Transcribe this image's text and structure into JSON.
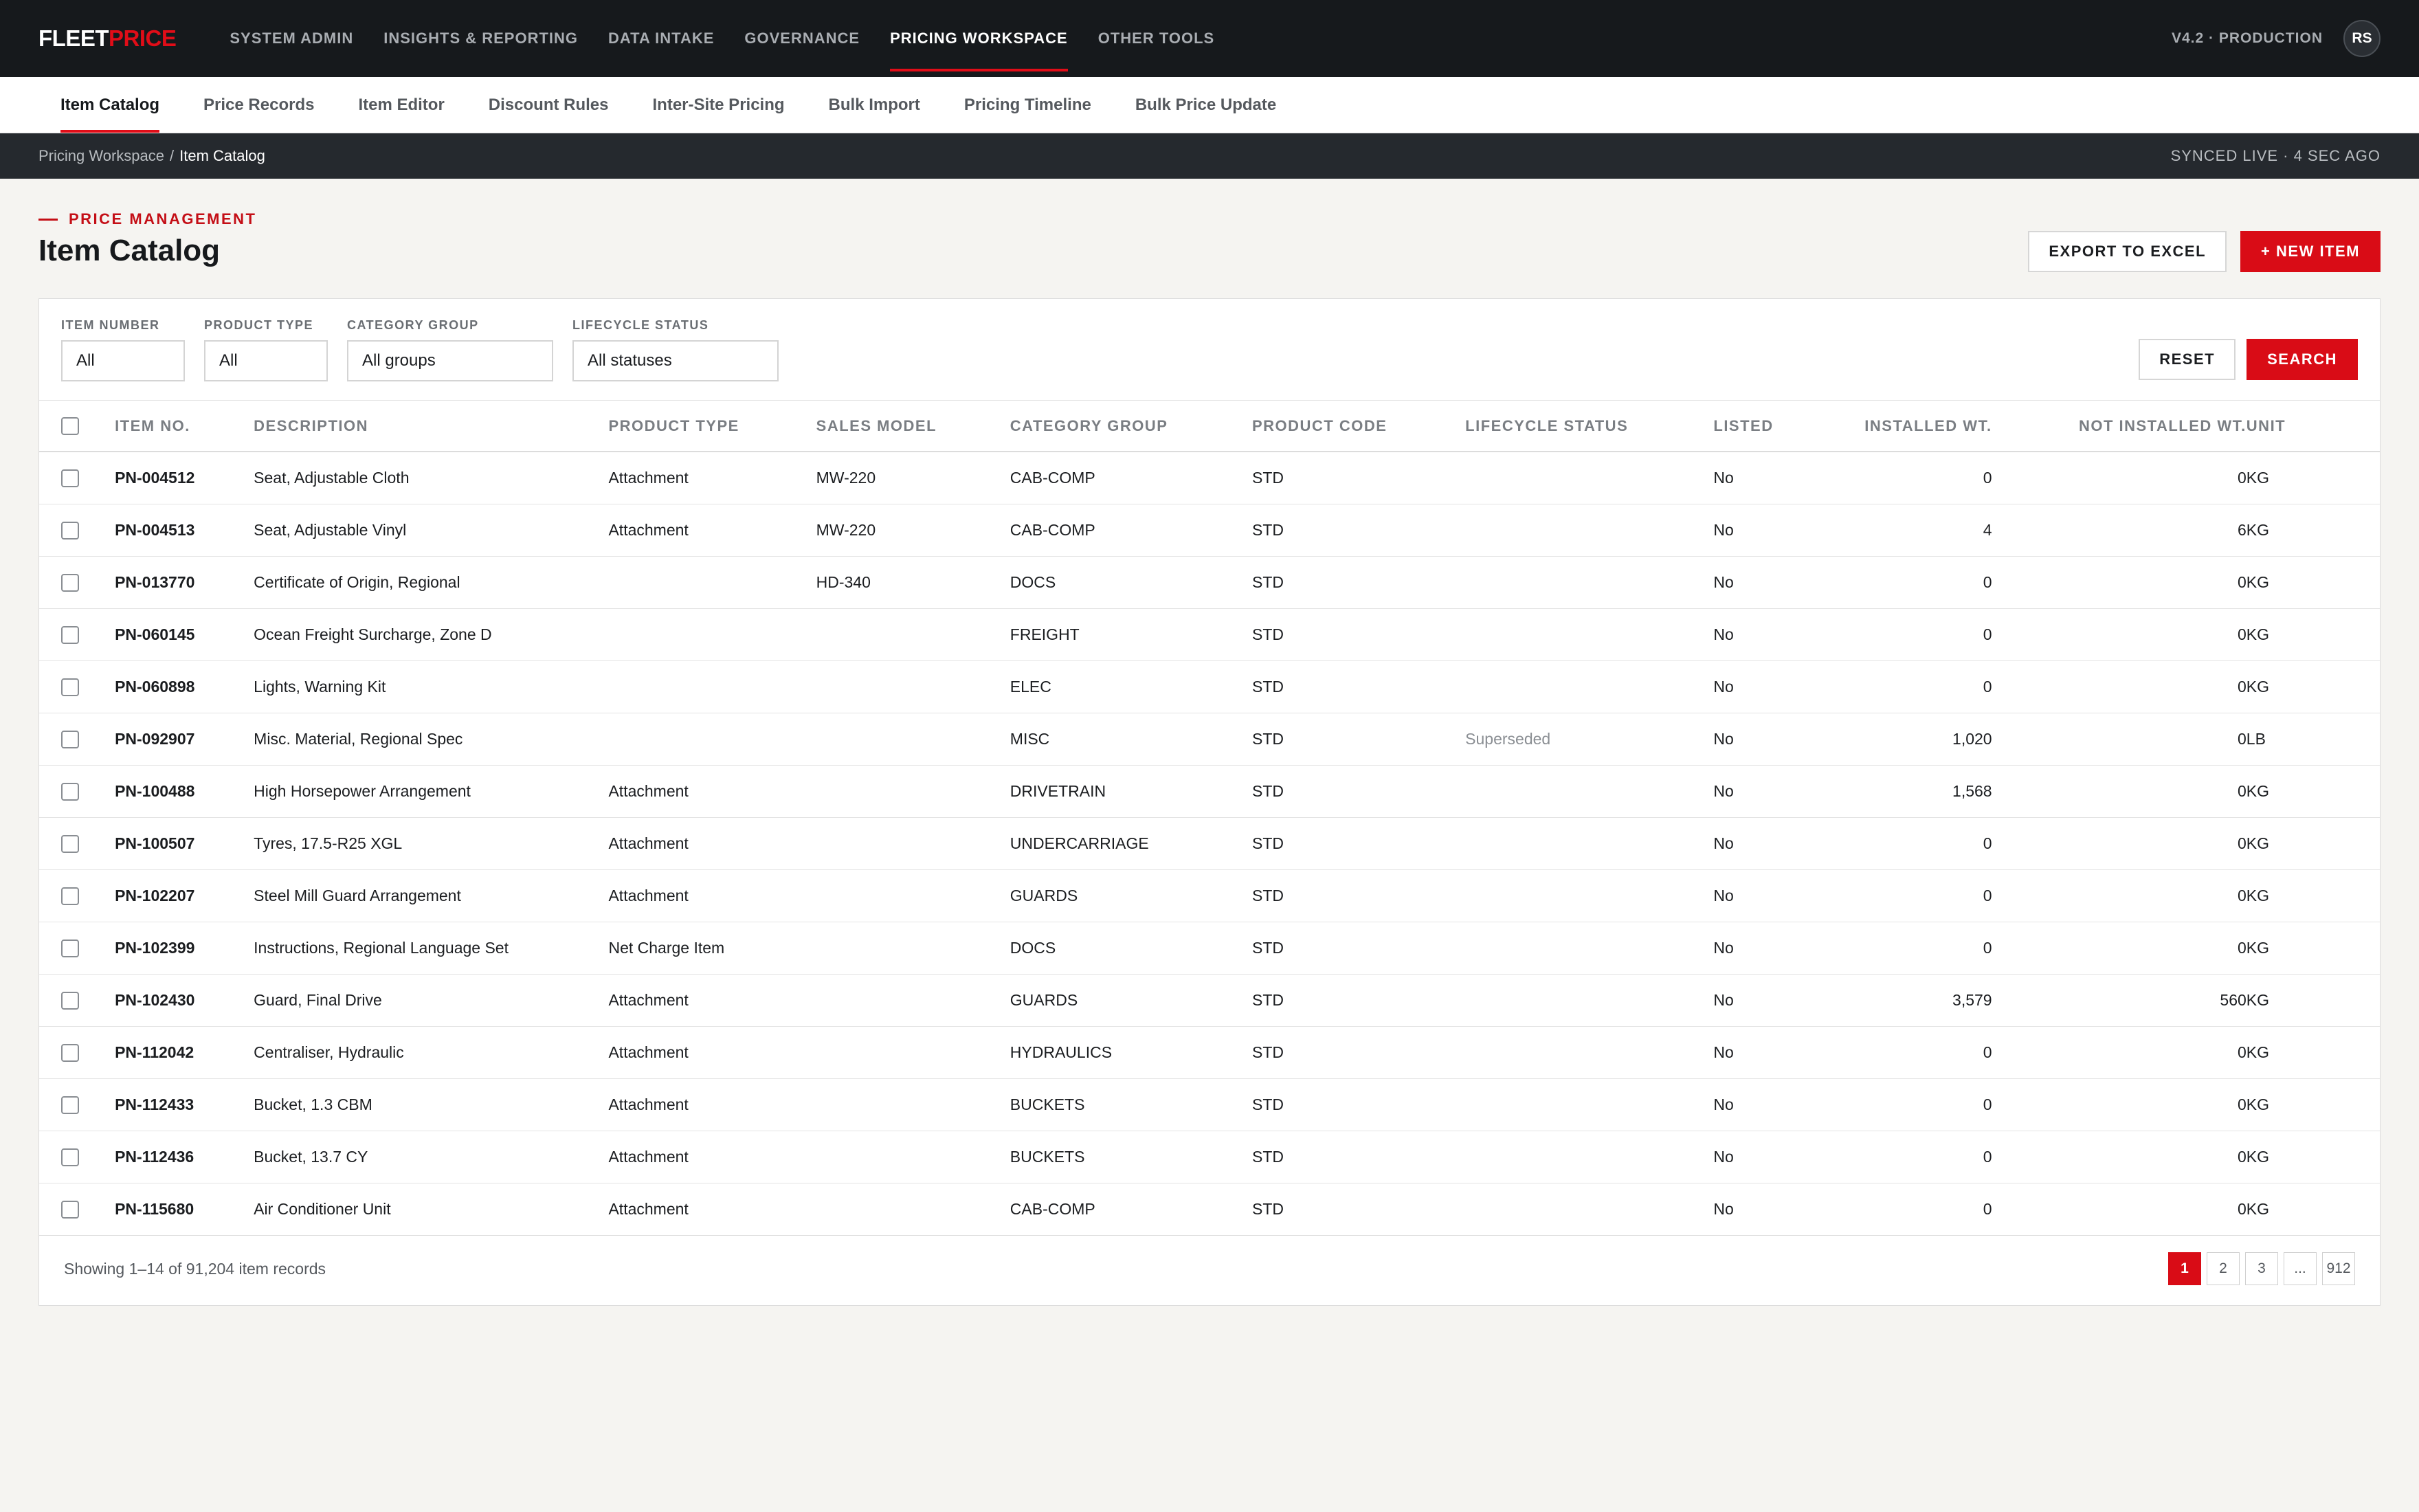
{
  "brand": {
    "part1": "FLEET",
    "part2": "PRICE"
  },
  "top_nav": [
    {
      "label": "SYSTEM ADMIN",
      "active": false
    },
    {
      "label": "INSIGHTS & REPORTING",
      "active": false
    },
    {
      "label": "DATA INTAKE",
      "active": false
    },
    {
      "label": "GOVERNANCE",
      "active": false
    },
    {
      "label": "PRICING WORKSPACE",
      "active": true
    },
    {
      "label": "OTHER TOOLS",
      "active": false
    }
  ],
  "environment": "V4.2 · PRODUCTION",
  "user_initials": "RS",
  "sub_nav": [
    {
      "label": "Item Catalog",
      "active": true
    },
    {
      "label": "Price Records",
      "active": false
    },
    {
      "label": "Item Editor",
      "active": false
    },
    {
      "label": "Discount Rules",
      "active": false
    },
    {
      "label": "Inter-Site Pricing",
      "active": false
    },
    {
      "label": "Bulk Import",
      "active": false
    },
    {
      "label": "Pricing Timeline",
      "active": false
    },
    {
      "label": "Bulk Price Update",
      "active": false
    }
  ],
  "breadcrumb": {
    "parent": "Pricing Workspace",
    "separator": "/",
    "current": "Item Catalog"
  },
  "sync_status": "SYNCED LIVE · 4 SEC AGO",
  "page": {
    "eyebrow": "PRICE MANAGEMENT",
    "title": "Item Catalog",
    "export_label": "EXPORT TO EXCEL",
    "new_item_label": "+ NEW ITEM"
  },
  "filters": {
    "item_number": {
      "label": "ITEM NUMBER",
      "value": "All"
    },
    "product_type": {
      "label": "PRODUCT TYPE",
      "value": "All"
    },
    "category_group": {
      "label": "CATEGORY GROUP",
      "value": "All groups"
    },
    "lifecycle_status": {
      "label": "LIFECYCLE STATUS",
      "value": "All statuses"
    },
    "reset_label": "RESET",
    "search_label": "SEARCH"
  },
  "table": {
    "columns": [
      "ITEM NO.",
      "DESCRIPTION",
      "PRODUCT TYPE",
      "SALES MODEL",
      "CATEGORY GROUP",
      "PRODUCT CODE",
      "LIFECYCLE STATUS",
      "LISTED",
      "INSTALLED WT.",
      "NOT INSTALLED WT.",
      "UNIT"
    ],
    "rows": [
      [
        "PN-004512",
        "Seat, Adjustable Cloth",
        "Attachment",
        "MW-220",
        "CAB-COMP",
        "STD",
        "",
        "No",
        "0",
        "0",
        "KG"
      ],
      [
        "PN-004513",
        "Seat, Adjustable Vinyl",
        "Attachment",
        "MW-220",
        "CAB-COMP",
        "STD",
        "",
        "No",
        "4",
        "6",
        "KG"
      ],
      [
        "PN-013770",
        "Certificate of Origin, Regional",
        "",
        "HD-340",
        "DOCS",
        "STD",
        "",
        "No",
        "0",
        "0",
        "KG"
      ],
      [
        "PN-060145",
        "Ocean Freight Surcharge, Zone D",
        "",
        "",
        "FREIGHT",
        "STD",
        "",
        "No",
        "0",
        "0",
        "KG"
      ],
      [
        "PN-060898",
        "Lights, Warning Kit",
        "",
        "",
        "ELEC",
        "STD",
        "",
        "No",
        "0",
        "0",
        "KG"
      ],
      [
        "PN-092907",
        "Misc. Material, Regional Spec",
        "",
        "",
        "MISC",
        "STD",
        "Superseded",
        "No",
        "1,020",
        "0",
        "LB"
      ],
      [
        "PN-100488",
        "High Horsepower Arrangement",
        "Attachment",
        "",
        "DRIVETRAIN",
        "STD",
        "",
        "No",
        "1,568",
        "0",
        "KG"
      ],
      [
        "PN-100507",
        "Tyres, 17.5-R25 XGL",
        "Attachment",
        "",
        "UNDERCARRIAGE",
        "STD",
        "",
        "No",
        "0",
        "0",
        "KG"
      ],
      [
        "PN-102207",
        "Steel Mill Guard Arrangement",
        "Attachment",
        "",
        "GUARDS",
        "STD",
        "",
        "No",
        "0",
        "0",
        "KG"
      ],
      [
        "PN-102399",
        "Instructions, Regional Language Set",
        "Net Charge Item",
        "",
        "DOCS",
        "STD",
        "",
        "No",
        "0",
        "0",
        "KG"
      ],
      [
        "PN-102430",
        "Guard, Final Drive",
        "Attachment",
        "",
        "GUARDS",
        "STD",
        "",
        "No",
        "3,579",
        "560",
        "KG"
      ],
      [
        "PN-112042",
        "Centraliser, Hydraulic",
        "Attachment",
        "",
        "HYDRAULICS",
        "STD",
        "",
        "No",
        "0",
        "0",
        "KG"
      ],
      [
        "PN-112433",
        "Bucket, 1.3 CBM",
        "Attachment",
        "",
        "BUCKETS",
        "STD",
        "",
        "No",
        "0",
        "0",
        "KG"
      ],
      [
        "PN-112436",
        "Bucket, 13.7 CY",
        "Attachment",
        "",
        "BUCKETS",
        "STD",
        "",
        "No",
        "0",
        "0",
        "KG"
      ],
      [
        "PN-115680",
        "Air Conditioner Unit",
        "Attachment",
        "",
        "CAB-COMP",
        "STD",
        "",
        "No",
        "0",
        "0",
        "KG"
      ]
    ]
  },
  "footer": {
    "showing": "Showing 1–14 of 91,204 item records",
    "pages": [
      {
        "label": "1",
        "active": true
      },
      {
        "label": "2",
        "active": false
      },
      {
        "label": "3",
        "active": false
      },
      {
        "label": "...",
        "active": false
      },
      {
        "label": "912",
        "active": false
      }
    ]
  },
  "colors": {
    "accent": "#d90c16",
    "topbar": "#16191c",
    "crumbbar": "#25292e",
    "page_bg": "#f5f4f1"
  }
}
